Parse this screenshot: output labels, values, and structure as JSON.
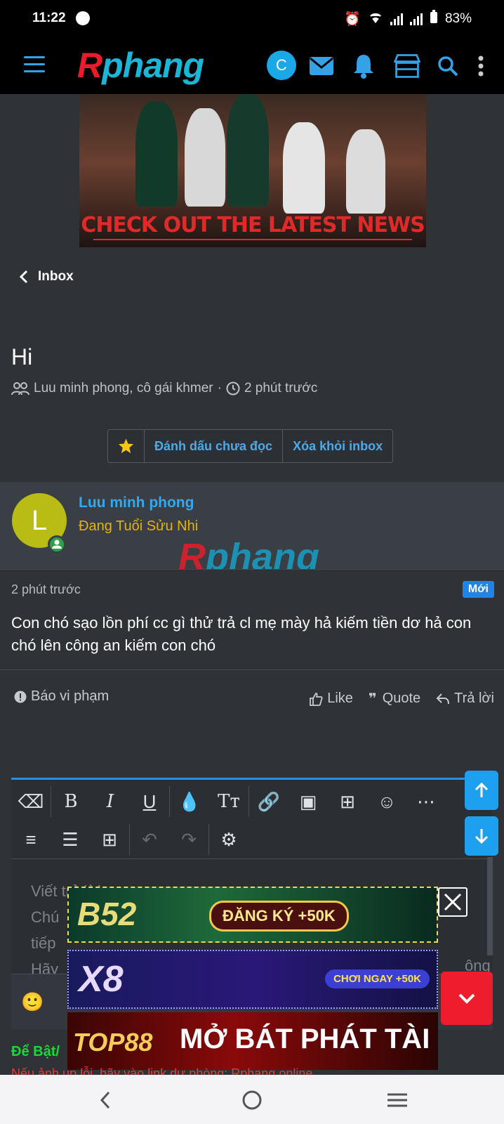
{
  "status_bar": {
    "time": "11:22",
    "battery": "83%"
  },
  "app_bar": {
    "logo_first": "R",
    "logo_rest": "phang",
    "user_initial": "C"
  },
  "banner": {
    "headline": "CHECK OUT THE LATEST NEWS"
  },
  "breadcrumb": {
    "back_label": "Inbox"
  },
  "conversation": {
    "title": "Hi",
    "participants": "Luu minh phong, cô gái khmer",
    "separator": "·",
    "time_ago": "2 phút trước",
    "buttons": {
      "mark_unread": "Đánh dấu chưa đọc",
      "remove_inbox": "Xóa khỏi inbox"
    }
  },
  "message": {
    "avatar_letter": "L",
    "author": "Luu minh phong",
    "author_title": "Đang Tuổi Sửu Nhi",
    "watermark_first": "R",
    "watermark_rest": "phang",
    "time_ago": "2 phút trước",
    "badge": "Mới",
    "content": "Con chó sạo lồn phí cc gì thử trả cl mẹ mày hả kiếm tiền dơ hả con chó lên công an kiếm con chó",
    "actions": {
      "report": "Báo vi phạm",
      "like": "Like",
      "quote": "Quote",
      "reply": "Trả lời"
    }
  },
  "editor": {
    "placeholder_lines": [
      "Viết trả lời...",
      "Chú",
      "tiếp",
      "Hãy"
    ],
    "placeholder_tail": "ông"
  },
  "ads": [
    {
      "brand": "B52",
      "cta": "ĐĂNG KÝ +50K"
    },
    {
      "brand": "X8",
      "cta": "CHƠI NGAY +50K"
    },
    {
      "brand": "TOP88",
      "cta": "MỞ BÁT PHÁT TÀI"
    }
  ],
  "footer_hint": {
    "line1": "Để Bật/",
    "line2": "Nếu ảnh up lỗi, hãy vào link dự phòng: Rphang.online"
  },
  "colors": {
    "accent": "#32a8f0",
    "link": "#4fa9e6",
    "author_title": "#e6b400",
    "badge": "#1e84e8",
    "danger": "#ee1d2e"
  }
}
